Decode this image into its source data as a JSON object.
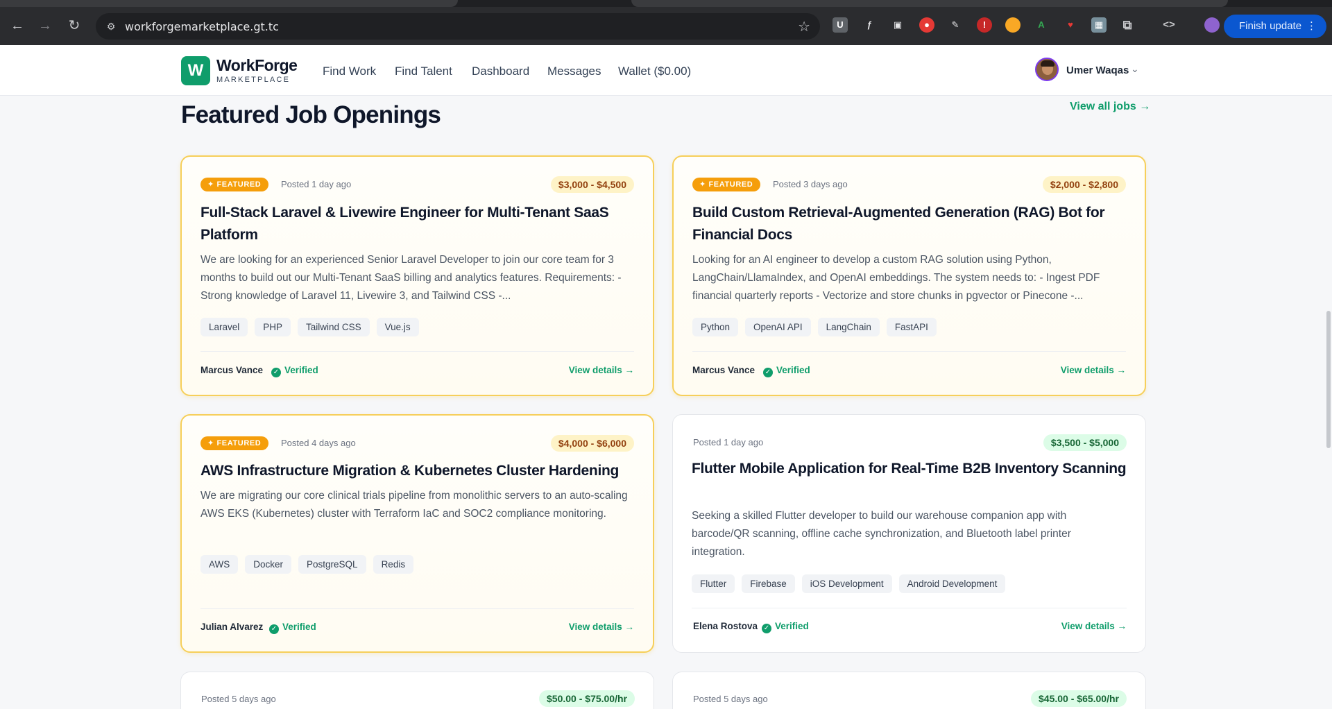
{
  "browser": {
    "url": "workforgemarketplace.gt.tc",
    "finish_update_label": "Finish update",
    "icons": [
      "back-icon",
      "forward-icon",
      "reload-icon",
      "site-settings-icon",
      "bookmark-star-icon",
      "extensions-icon",
      "devtools-icon",
      "more-icon"
    ]
  },
  "header": {
    "logo_letter": "W",
    "brand_name": "WorkForge",
    "brand_sub": "MARKETPLACE",
    "nav": [
      {
        "label": "Find Work"
      },
      {
        "label": "Find Talent"
      },
      {
        "label": "Dashboard"
      },
      {
        "label": "Messages"
      },
      {
        "label": "Wallet ($0.00)"
      }
    ],
    "user_name": "Umer Waqas"
  },
  "section": {
    "title": "Featured Job Openings",
    "view_all_label": "View all jobs →"
  },
  "jobs": [
    {
      "featured_label": "FEATURED",
      "posted": "Posted 1 day ago",
      "price": "$3,000 - $4,500",
      "title": "Full-Stack Laravel & Livewire Engineer for Multi-Tenant SaaS Platform",
      "description": "We are looking for an experienced Senior Laravel Developer to join our core team for 3 months to build out our Multi-Tenant SaaS billing and analytics features. Requirements: - Strong knowledge of Laravel 11, Livewire 3, and Tailwind CSS -...",
      "tags": [
        "Laravel",
        "PHP",
        "Tailwind CSS",
        "Vue.js"
      ],
      "client": "Marcus Vance",
      "verified": "Verified",
      "view_label": "View details →"
    },
    {
      "featured_label": "FEATURED",
      "posted": "Posted 3 days ago",
      "price": "$2,000 - $2,800",
      "title": "Build Custom Retrieval-Augmented Generation (RAG) Bot for Financial Docs",
      "description": "Looking for an AI engineer to develop a custom RAG solution using Python, LangChain/LlamaIndex, and OpenAI embeddings. The system needs to: - Ingest PDF financial quarterly reports - Vectorize and store chunks in pgvector or Pinecone -...",
      "tags": [
        "Python",
        "OpenAI API",
        "LangChain",
        "FastAPI"
      ],
      "client": "Marcus Vance",
      "verified": "Verified",
      "view_label": "View details →"
    },
    {
      "featured_label": "FEATURED",
      "posted": "Posted 4 days ago",
      "price": "$4,000 - $6,000",
      "title": "AWS Infrastructure Migration & Kubernetes Cluster Hardening",
      "description": "We are migrating our core clinical trials pipeline from monolithic servers to an auto-scaling AWS EKS (Kubernetes) cluster with Terraform IaC and SOC2 compliance monitoring.",
      "tags": [
        "AWS",
        "Docker",
        "PostgreSQL",
        "Redis"
      ],
      "client": "Julian Alvarez",
      "verified": "Verified",
      "view_label": "View details →"
    },
    {
      "posted": "Posted 1 day ago",
      "price": "$3,500 - $5,000",
      "title": "Flutter Mobile Application for Real-Time B2B Inventory Scanning",
      "description": "Seeking a skilled Flutter developer to build our warehouse companion app with barcode/QR scanning, offline cache synchronization, and Bluetooth label printer integration.",
      "tags": [
        "Flutter",
        "Firebase",
        "iOS Development",
        "Android Development"
      ],
      "client": "Elena Rostova",
      "verified": "Verified",
      "view_label": "View details →"
    },
    {
      "posted": "Posted 5 days ago",
      "price": "$50.00 - $75.00/hr"
    },
    {
      "posted": "Posted 5 days ago",
      "price": "$45.00 - $65.00/hr"
    }
  ],
  "colors": {
    "brand_green": "#0f9d6b",
    "featured_border": "#f6cf5a",
    "featured_badge": "#f59e0b"
  }
}
